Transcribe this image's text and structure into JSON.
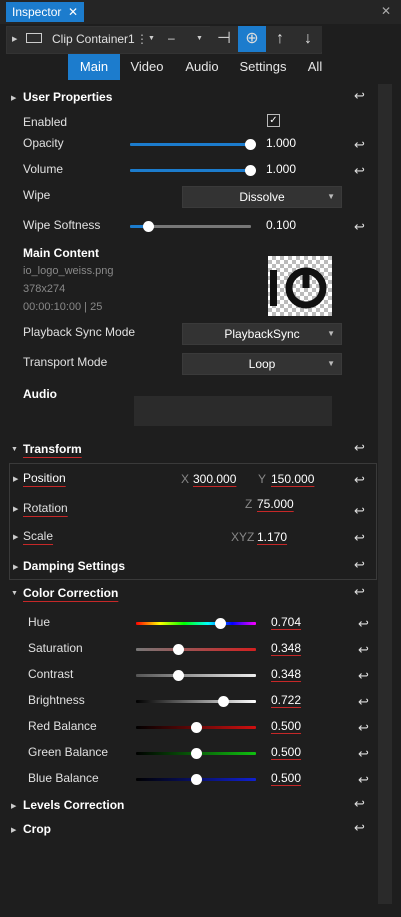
{
  "tab": {
    "title": "Inspector",
    "close": "✕"
  },
  "window": {
    "close": "✕"
  },
  "toolbar": {
    "name": "Clip Container1",
    "more": "⋮",
    "dash": "–"
  },
  "subtabs": [
    "Main",
    "Video",
    "Audio",
    "Settings",
    "All"
  ],
  "user_properties": {
    "title": "User Properties",
    "enabled_label": "Enabled",
    "enabled_check": "✓",
    "opacity_label": "Opacity",
    "opacity_value": "1.000",
    "volume_label": "Volume",
    "volume_value": "1.000",
    "wipe_label": "Wipe",
    "wipe_value": "Dissolve",
    "wipe_softness_label": "Wipe Softness",
    "wipe_softness_value": "0.100",
    "main_content_title": "Main Content",
    "file_name": "io_logo_weiss.png",
    "file_dims": "378x274",
    "file_time": "00:00:10:00 | 25",
    "playback_label": "Playback Sync Mode",
    "playback_value": "PlaybackSync",
    "transport_label": "Transport Mode",
    "transport_value": "Loop",
    "audio_title": "Audio"
  },
  "transform": {
    "title": "Transform",
    "position_label": "Position",
    "x_axis": "X",
    "x_value": "300.000",
    "y_axis": "Y",
    "y_value": "150.000",
    "rotation_label": "Rotation",
    "z_axis": "Z",
    "z_value": "75.000",
    "scale_label": "Scale",
    "xyz_axis": "XYZ",
    "scale_value": "1.170",
    "damping_title": "Damping Settings"
  },
  "color_correction": {
    "title": "Color Correction",
    "rows": [
      {
        "label": "Hue",
        "value": "0.704"
      },
      {
        "label": "Saturation",
        "value": "0.348"
      },
      {
        "label": "Contrast",
        "value": "0.348"
      },
      {
        "label": "Brightness",
        "value": "0.722"
      },
      {
        "label": "Red Balance",
        "value": "0.500"
      },
      {
        "label": "Green Balance",
        "value": "0.500"
      },
      {
        "label": "Blue Balance",
        "value": "0.500"
      }
    ]
  },
  "levels_title": "Levels Correction",
  "crop_title": "Crop",
  "reset_icon": "↩",
  "accent": "#1c7ccd",
  "invalid_underline": "#c62828"
}
